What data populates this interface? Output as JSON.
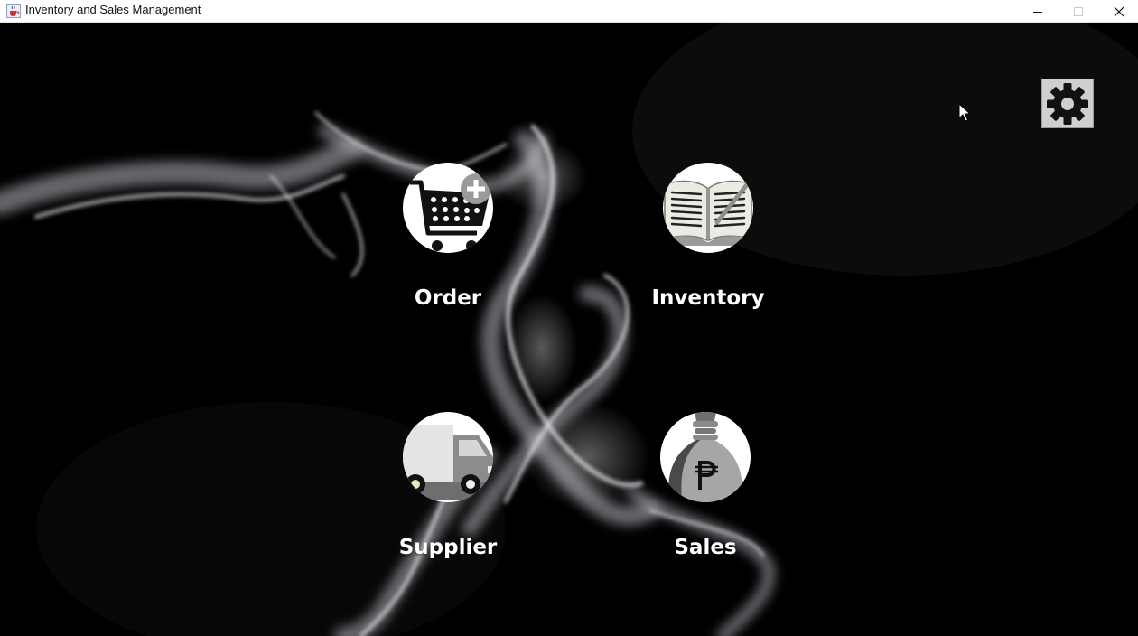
{
  "window": {
    "title": "Inventory and Sales Management",
    "icons": {
      "app": "java-cup-icon",
      "minimize": "minimize-icon",
      "maximize": "maximize-icon",
      "close": "close-icon"
    }
  },
  "settings": {
    "icon": "gear-icon"
  },
  "menu": [
    {
      "label": "Order",
      "icon": "shopping-cart-add-icon"
    },
    {
      "label": "Inventory",
      "icon": "open-book-icon"
    },
    {
      "label": "Supplier",
      "icon": "delivery-truck-icon"
    },
    {
      "label": "Sales",
      "icon": "money-bag-peso-icon"
    }
  ],
  "colors": {
    "background": "#000000",
    "label": "#ffffff",
    "titlebar": "#ffffff"
  }
}
